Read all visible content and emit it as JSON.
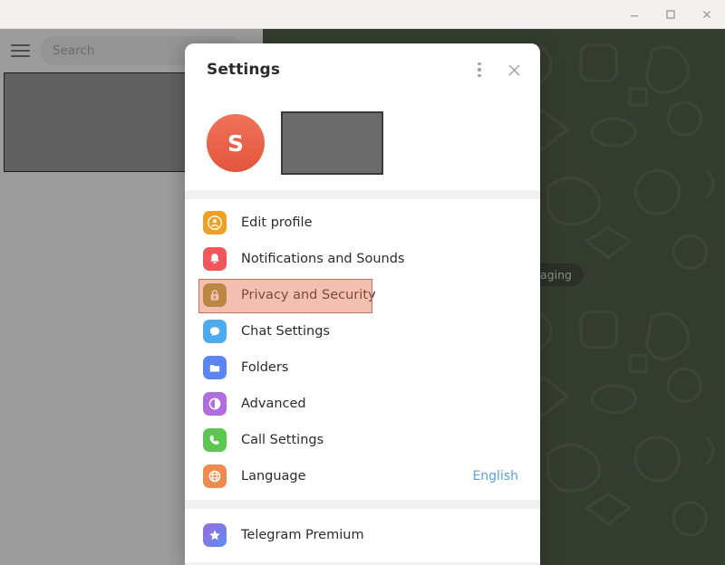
{
  "window": {
    "controls": [
      {
        "name": "minimize",
        "glyph": "minimize-icon"
      },
      {
        "name": "maximize",
        "glyph": "maximize-icon"
      },
      {
        "name": "close",
        "glyph": "close-icon"
      }
    ]
  },
  "app": {
    "search": {
      "placeholder": "Search",
      "value": ""
    },
    "menu_icon": "hamburger-icon",
    "chat_background": {
      "color": "#4c5a44",
      "date_pill_text": "ssaging"
    }
  },
  "dialog": {
    "title": "Settings",
    "more_icon": "more-vertical-icon",
    "close_icon": "close-icon",
    "profile": {
      "avatar_initial": "S",
      "avatar_color": "#e2553c"
    },
    "menu": [
      {
        "label": "Edit profile",
        "icon": "person-icon",
        "icon_color": "#f0a023",
        "value": "",
        "highlighted": false
      },
      {
        "label": "Notifications and Sounds",
        "icon": "bell-icon",
        "icon_color": "#f2565b",
        "value": "",
        "highlighted": false
      },
      {
        "label": "Privacy and Security",
        "icon": "lock-icon",
        "icon_color": "#9b9a3a",
        "value": "",
        "highlighted": true
      },
      {
        "label": "Chat Settings",
        "icon": "chat-bubble-icon",
        "icon_color": "#4daaf0",
        "value": "",
        "highlighted": false
      },
      {
        "label": "Folders",
        "icon": "folder-icon",
        "icon_color": "#5b84f5",
        "value": "",
        "highlighted": false
      },
      {
        "label": "Advanced",
        "icon": "pie-icon",
        "icon_color": "#b06de0",
        "value": "",
        "highlighted": false
      },
      {
        "label": "Call Settings",
        "icon": "phone-icon",
        "icon_color": "#5bc750",
        "value": "",
        "highlighted": false
      },
      {
        "label": "Language",
        "icon": "globe-icon",
        "icon_color": "#f08b4f",
        "value": "English",
        "highlighted": false
      }
    ],
    "premium": {
      "label": "Telegram Premium",
      "icon": "star-icon"
    },
    "highlight_color": "#e2705080",
    "accent_color": "#56a3e0"
  }
}
